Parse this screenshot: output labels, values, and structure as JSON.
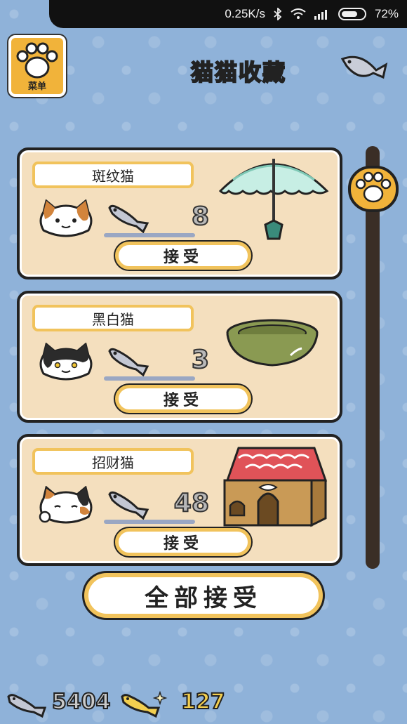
{
  "status_bar": {
    "net_speed": "0.25K/s",
    "battery": "72%"
  },
  "menu": {
    "label": "菜单"
  },
  "header": {
    "title": "猫猫收藏"
  },
  "cards": [
    {
      "cat_name": "斑纹猫",
      "fish": "8",
      "accept_label": "接受",
      "goodie_icon": "umbrella-icon"
    },
    {
      "cat_name": "黑白猫",
      "fish": "3",
      "accept_label": "接受",
      "goodie_icon": "bowl-icon"
    },
    {
      "cat_name": "招财猫",
      "fish": "48",
      "accept_label": "接受",
      "goodie_icon": "cat-house-icon"
    }
  ],
  "accept_all_label": "全部接受",
  "currency": {
    "silver_fish": "5404",
    "gold_fish": "127"
  },
  "colors": {
    "card": "#f4dfbe",
    "accent": "#f1c35c",
    "background": "#8fb2d9"
  }
}
